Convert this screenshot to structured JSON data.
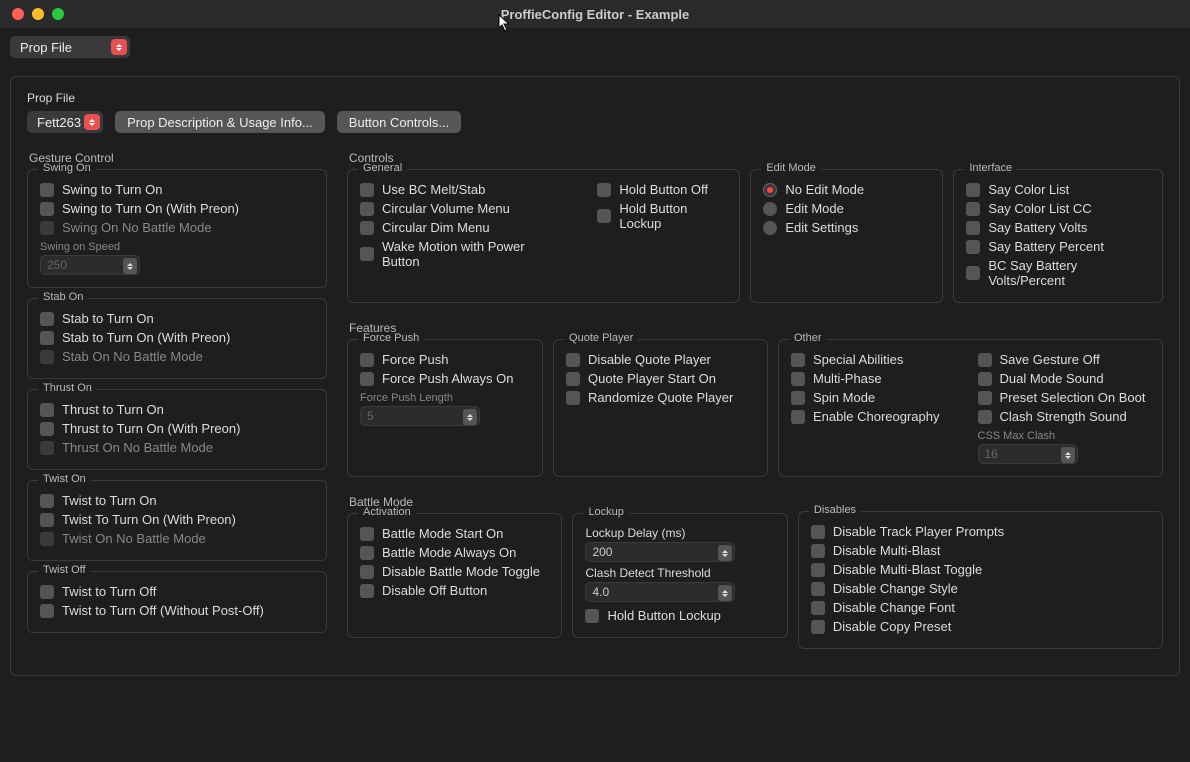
{
  "window": {
    "title": "ProffieConfig Editor - Example"
  },
  "toolbar": {
    "prop_file_select": "Prop File"
  },
  "propfile": {
    "label": "Prop File",
    "selected": "Fett263",
    "btn_desc": "Prop Description & Usage Info...",
    "btn_controls": "Button Controls..."
  },
  "gesture": {
    "title": "Gesture Control",
    "swing_on": {
      "legend": "Swing On",
      "opt1": "Swing to Turn On",
      "opt2": "Swing to Turn On (With Preon)",
      "opt3": "Swing On No Battle Mode",
      "speed_label": "Swing on Speed",
      "speed_val": "250"
    },
    "stab_on": {
      "legend": "Stab On",
      "opt1": "Stab to Turn On",
      "opt2": "Stab to Turn On (With Preon)",
      "opt3": "Stab On No Battle Mode"
    },
    "thrust_on": {
      "legend": "Thrust On",
      "opt1": "Thrust to Turn On",
      "opt2": "Thrust to Turn On (With Preon)",
      "opt3": "Thrust On No Battle Mode"
    },
    "twist_on": {
      "legend": "Twist On",
      "opt1": "Twist to Turn On",
      "opt2": "Twist To Turn On (With Preon)",
      "opt3": "Twist On No Battle Mode"
    },
    "twist_off": {
      "legend": "Twist Off",
      "opt1": "Twist to Turn Off",
      "opt2": "Twist to Turn Off (Without Post-Off)"
    }
  },
  "controls": {
    "title": "Controls",
    "general": {
      "legend": "General",
      "c1": "Use BC Melt/Stab",
      "c2": "Circular Volume Menu",
      "c3": "Circular Dim Menu",
      "c4": "Wake Motion with Power Button",
      "c5": "Hold Button Off",
      "c6": "Hold Button Lockup"
    },
    "editmode": {
      "legend": "Edit Mode",
      "r1": "No Edit Mode",
      "r2": "Edit Mode",
      "r3": "Edit Settings"
    },
    "interface": {
      "legend": "Interface",
      "c1": "Say Color List",
      "c2": "Say Color List CC",
      "c3": "Say Battery Volts",
      "c4": "Say Battery Percent",
      "c5": "BC Say Battery Volts/Percent"
    }
  },
  "features": {
    "title": "Features",
    "forcepush": {
      "legend": "Force Push",
      "c1": "Force Push",
      "c2": "Force Push Always On",
      "len_label": "Force Push Length",
      "len_val": "5"
    },
    "quote": {
      "legend": "Quote Player",
      "c1": "Disable Quote Player",
      "c2": "Quote Player Start On",
      "c3": "Randomize Quote Player"
    },
    "other": {
      "legend": "Other",
      "left": {
        "c1": "Special Abilities",
        "c2": "Multi-Phase",
        "c3": "Spin Mode",
        "c4": "Enable Choreography"
      },
      "right": {
        "c1": "Save Gesture Off",
        "c2": "Dual Mode Sound",
        "c3": "Preset Selection On Boot",
        "c4": "Clash Strength Sound",
        "max_label": "CSS Max Clash",
        "max_val": "16"
      }
    }
  },
  "battle": {
    "title": "Battle Mode",
    "activation": {
      "legend": "Activation",
      "c1": "Battle Mode Start On",
      "c2": "Battle Mode Always On",
      "c3": "Disable Battle Mode Toggle",
      "c4": "Disable Off Button"
    },
    "lockup": {
      "legend": "Lockup",
      "delay_label": "Lockup Delay (ms)",
      "delay_val": "200",
      "clash_label": "Clash Detect Threshold",
      "clash_val": "4.0",
      "c1": "Hold Button Lockup"
    },
    "disables": {
      "legend": "Disables",
      "c1": "Disable Track Player Prompts",
      "c2": "Disable Multi-Blast",
      "c3": "Disable Multi-Blast Toggle",
      "c4": "Disable Change Style",
      "c5": "Disable Change Font",
      "c6": "Disable Copy Preset"
    }
  }
}
